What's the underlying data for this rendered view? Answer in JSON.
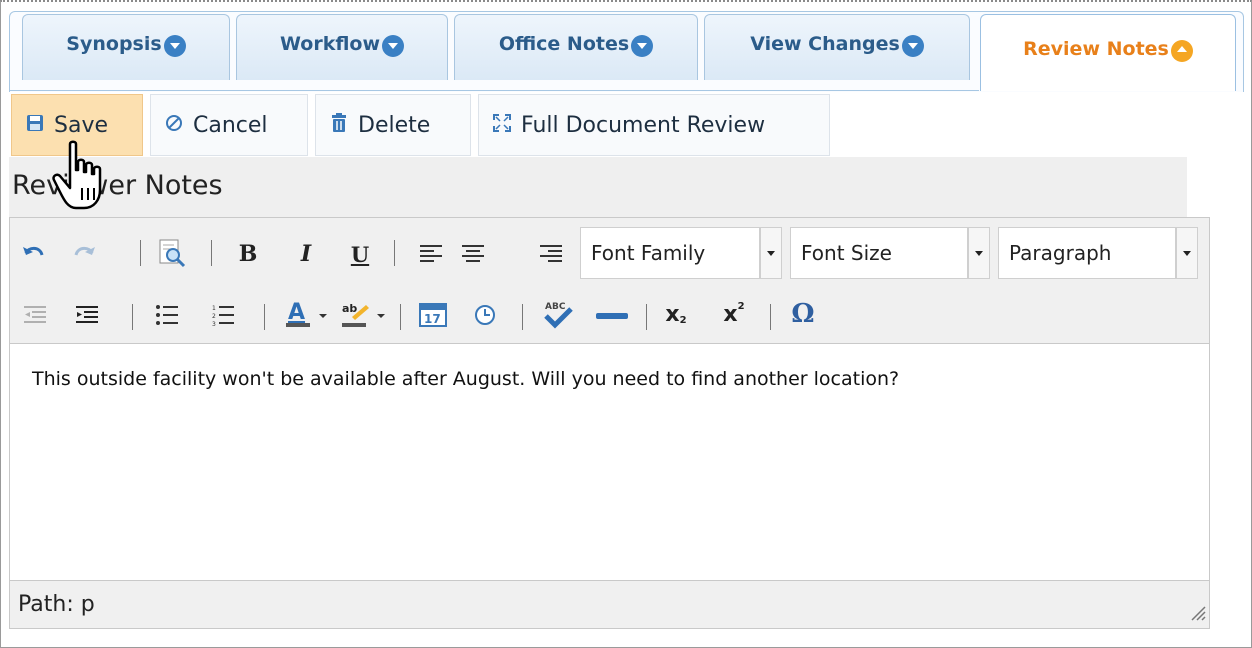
{
  "tabs": [
    {
      "label": "Synopsis",
      "active": false
    },
    {
      "label": "Workflow",
      "active": false
    },
    {
      "label": "Office Notes",
      "active": false
    },
    {
      "label": "View Changes",
      "active": false
    },
    {
      "label": "Review Notes",
      "active": true
    }
  ],
  "toolbar": {
    "save_label": "Save",
    "cancel_label": "Cancel",
    "delete_label": "Delete",
    "full_review_label": "Full Document Review"
  },
  "section": {
    "title": "Reviewer Notes"
  },
  "editor": {
    "font_family": "Font Family",
    "font_size": "Font Size",
    "format": "Paragraph",
    "content": "This outside facility won't be available after August. Will you need to find another location?",
    "path": "Path: p"
  },
  "colors": {
    "active_tab_text": "#e8801a",
    "tab_text": "#2b5c8a",
    "save_button_bg": "#fce0b0",
    "tab_chevron": "#3a80c4",
    "active_chevron": "#f5a623"
  }
}
